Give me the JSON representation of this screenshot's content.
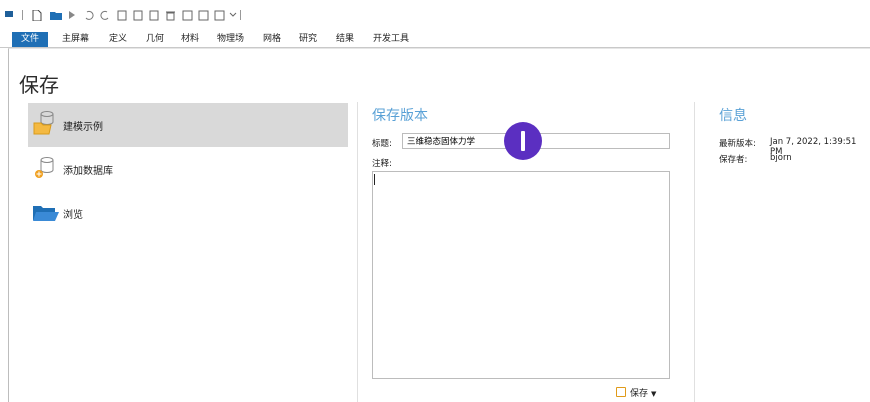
{
  "ribbon": {
    "tabs": [
      {
        "label": "文件"
      },
      {
        "label": "主屏幕"
      },
      {
        "label": "定义"
      },
      {
        "label": "几何"
      },
      {
        "label": "材料"
      },
      {
        "label": "物理场"
      },
      {
        "label": "网格"
      },
      {
        "label": "研究"
      },
      {
        "label": "结果"
      },
      {
        "label": "开发工具"
      }
    ],
    "active_color": "#1f6fb5"
  },
  "page": {
    "title": "保存"
  },
  "sidebar": {
    "items": [
      {
        "label": "建模示例",
        "icon": "folder-database-icon",
        "selected": true
      },
      {
        "label": "添加数据库",
        "icon": "add-database-icon",
        "selected": false
      },
      {
        "label": "浏览",
        "icon": "open-folder-icon",
        "selected": false
      }
    ]
  },
  "save_version": {
    "heading": "保存版本",
    "title_label": "标题:",
    "title_value": "三维稳态固体力学",
    "comment_label": "注释:",
    "comment_value": "",
    "save_button": "保存"
  },
  "info": {
    "heading": "信息",
    "latest_label": "最新版本:",
    "latest_value": "Jan 7, 2022, 1:39:51 PM",
    "saved_by_label": "保存者:",
    "saved_by_value": "bjorn"
  }
}
